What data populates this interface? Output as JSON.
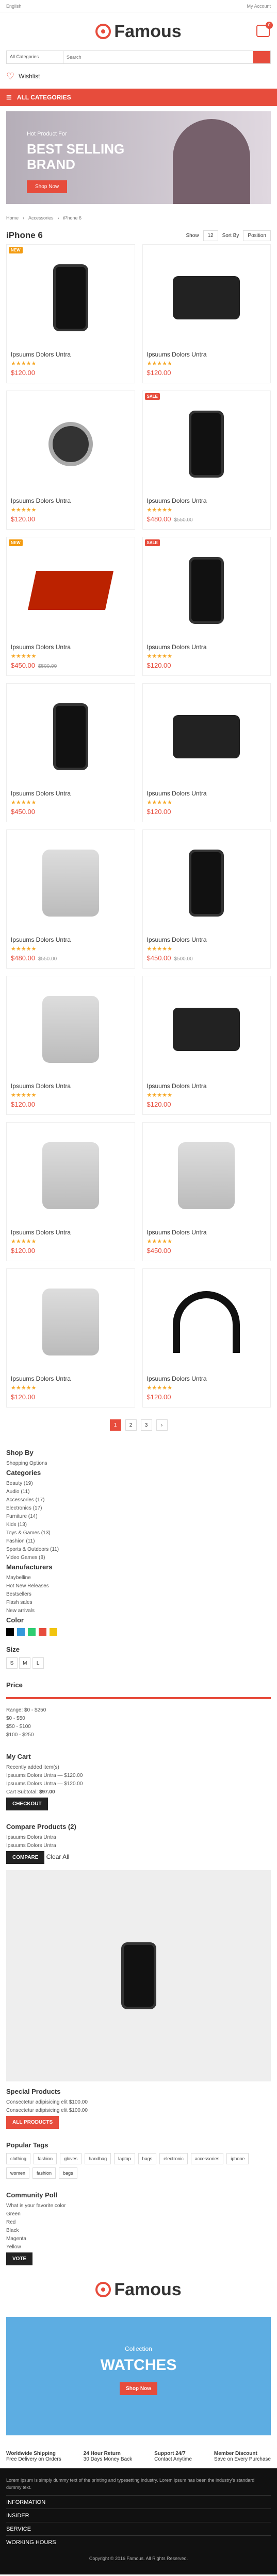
{
  "topbar": {
    "language": "English",
    "account": "My Account"
  },
  "brand": {
    "name": "Famous",
    "cart_count": "0"
  },
  "search": {
    "category": "All Categories",
    "placeholder": "Search"
  },
  "menu": {
    "wishlist": "Wishlist",
    "categories": "ALL CATEGORIES"
  },
  "banner": {
    "small": "Hot Product For",
    "big1": "BEST SELLING",
    "big2": "BRAND",
    "button": "Shop Now"
  },
  "breadcrumb": {
    "home": "Home",
    "parent": "Accessories",
    "current": "iPhone 6"
  },
  "page": {
    "title": "iPhone 6",
    "show_label": "Show",
    "show_value": "12",
    "sort_label": "Sort By",
    "sort_value": "Position"
  },
  "products": [
    {
      "name": "Ipsuums Dolors Untra",
      "price": "$120.00",
      "old": "",
      "tag": "NEW",
      "image": "phone"
    },
    {
      "name": "Ipsuums Dolors Untra",
      "price": "$120.00",
      "old": "",
      "tag": "",
      "image": "camera"
    },
    {
      "name": "Ipsuums Dolors Untra",
      "price": "$120.00",
      "old": "",
      "tag": "",
      "image": "watch"
    },
    {
      "name": "Ipsuums Dolors Untra",
      "price": "$480.00",
      "old": "$550.00",
      "tag": "SALE",
      "image": "phone"
    },
    {
      "name": "Ipsuums Dolors Untra",
      "price": "$450.00",
      "old": "$500.00",
      "tag": "NEW",
      "image": "laptop"
    },
    {
      "name": "Ipsuums Dolors Untra",
      "price": "$120.00",
      "old": "",
      "tag": "SALE",
      "image": "phone"
    },
    {
      "name": "Ipsuums Dolors Untra",
      "price": "$450.00",
      "old": "",
      "tag": "",
      "image": "phone"
    },
    {
      "name": "Ipsuums Dolors Untra",
      "price": "$120.00",
      "old": "",
      "tag": "",
      "image": "camera"
    },
    {
      "name": "Ipsuums Dolors Untra",
      "price": "$480.00",
      "old": "$550.00",
      "tag": "",
      "image": "device"
    },
    {
      "name": "Ipsuums Dolors Untra",
      "price": "$450.00",
      "old": "$500.00",
      "tag": "",
      "image": "phone"
    },
    {
      "name": "Ipsuums Dolors Untra",
      "price": "$120.00",
      "old": "",
      "tag": "",
      "image": "device"
    },
    {
      "name": "Ipsuums Dolors Untra",
      "price": "$120.00",
      "old": "",
      "tag": "",
      "image": "camera"
    },
    {
      "name": "Ipsuums Dolors Untra",
      "price": "$120.00",
      "old": "",
      "tag": "",
      "image": "device"
    },
    {
      "name": "Ipsuums Dolors Untra",
      "price": "$450.00",
      "old": "",
      "tag": "",
      "image": "device"
    },
    {
      "name": "Ipsuums Dolors Untra",
      "price": "$120.00",
      "old": "",
      "tag": "",
      "image": "device"
    },
    {
      "name": "Ipsuums Dolors Untra",
      "price": "$120.00",
      "old": "",
      "tag": "",
      "image": "headphones"
    }
  ],
  "pagination": [
    "1",
    "2",
    "3",
    "›"
  ],
  "filters": {
    "shop_by": "Shop By",
    "previously": "Shopping Options",
    "categories_title": "Categories",
    "categories": [
      "Beauty (19)",
      "Audio (11)",
      "Accessories (17)",
      "Electronics (17)",
      "Furniture (14)",
      "Kids (13)",
      "Toys & Games (13)",
      "Fashion (11)",
      "Sports & Outdoors (11)",
      "Video Games (8)"
    ],
    "manufacturer_title": "Manufacturers",
    "manufacturers": [
      "Maybelline",
      "Hot New Releases",
      "Bestsellers",
      "Flash sales",
      "New arrivals"
    ],
    "color_title": "Color",
    "size_title": "Size",
    "price_title": "Price",
    "price_range": "Range: $0 - $250",
    "price_options": [
      "$0 - $50",
      "$50 - $100",
      "$100 - $250"
    ]
  },
  "cart": {
    "title": "My Cart",
    "note": "Recently added item(s)",
    "item1": "Ipsuums Dolors Untra",
    "price1": "$120.00",
    "item2": "Ipsuums Dolors Untra",
    "price2": "$120.00",
    "subtotal_label": "Cart Subtotal:",
    "subtotal": "$97.00",
    "checkout": "CHECKOUT"
  },
  "compare": {
    "title": "Compare Products",
    "count": "2",
    "item1": "Ipsuums Dolors Untra",
    "item2": "Ipsuums Dolors Untra",
    "button": "COMPARE",
    "clear": "Clear All"
  },
  "special": {
    "title": "Special Products",
    "item1": "Consectetur adipisicing elit",
    "price1": "$100.00",
    "item2": "Consectetur adipisicing elit",
    "price2": "$100.00",
    "button": "ALL PRODUCTS"
  },
  "popular": {
    "title": "Popular Tags",
    "tags": [
      "clothing",
      "fashion",
      "gloves",
      "handbag",
      "laptop",
      "bags",
      "electronic",
      "accessories",
      "iphone",
      "women",
      "fashion",
      "bags"
    ]
  },
  "poll": {
    "title": "Community Poll",
    "question": "What is your favorite color",
    "options": [
      "Green",
      "Red",
      "Black",
      "Magenta",
      "Yellow"
    ],
    "button": "VOTE"
  },
  "ad": {
    "small": "Collection",
    "big": "WATCHES",
    "button": "Shop Now"
  },
  "services": [
    {
      "title": "Worldwide Shipping",
      "text": "Free Delivery on Orders"
    },
    {
      "title": "24 Hour Return",
      "text": "30 Days Money Back"
    },
    {
      "title": "Support 24/7",
      "text": "Contact Anytime"
    },
    {
      "title": "Member Discount",
      "text": "Save on Every Purchase"
    }
  ],
  "footer": {
    "description": "Lorem ipsum is simply dummy text of the printing and typesetting industry. Lorem ipsum has been the industry's standard dummy text.",
    "menu": [
      "INFORMATION",
      "INSIDER",
      "SERVICE",
      "WORKING HOURS"
    ],
    "copyright": "Copyright © 2016 Famous. All Rights Reserved."
  },
  "colors": {
    "accent": "#e74c3c",
    "dark": "#111111"
  }
}
